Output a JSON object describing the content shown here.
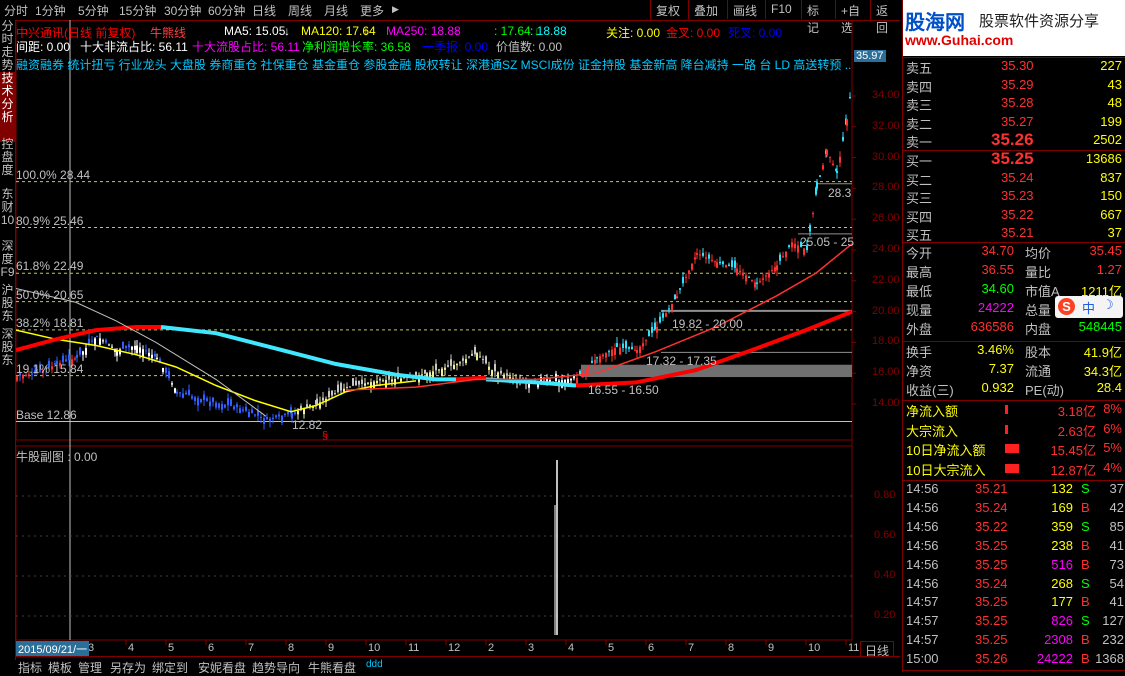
{
  "toolbar": {
    "periods": [
      "分时",
      "1分钟",
      "5分钟",
      "15分钟",
      "30分钟",
      "60分钟",
      "日线",
      "周线",
      "月线",
      "更多"
    ],
    "more_arrow": "▶",
    "right_buttons": [
      "复权",
      "叠加",
      "画线",
      "F10",
      "标记",
      "+自选",
      "返回"
    ]
  },
  "left_tabs": [
    "分时走势",
    "技术分析",
    "控盘度",
    "东财10",
    "深度F9",
    "沪股东",
    "深股东"
  ],
  "chart": {
    "title": "中兴通讯(日线 前复权)",
    "indicator_name": "牛熊线",
    "ma": [
      {
        "label": "MA5: 15.05",
        "arrow": "↓",
        "color": "#ffffff"
      },
      {
        "label": "MA120: 17.64",
        "arrow": "↓",
        "color": "#ffff00"
      },
      {
        "label": "MA250: 18.88",
        "arrow": "↓",
        "color": "#ff00ff"
      },
      {
        "label": ": 17.64",
        "arrow": "↓",
        "color": "#00ff00"
      },
      {
        "label": ": 18.88",
        "arrow": "",
        "color": "#00ffff"
      },
      {
        "label": "关注: 0.00",
        "arrow": "",
        "color": "#ffff00"
      },
      {
        "label": "金叉: 0.00",
        "arrow": "",
        "color": "#ff0000"
      },
      {
        "label": "死叉: 0.00",
        "arrow": "",
        "color": "#0000ff"
      }
    ],
    "line2": [
      {
        "label": "间距: 0.00",
        "color": "#ffffff"
      },
      {
        "label": "十大非流占比: 56.11",
        "color": "#ffffff"
      },
      {
        "label": "十大流股占比: 56.11",
        "color": "#ff00ff"
      },
      {
        "label": "净利润增长率: 36.58",
        "color": "#00ff00"
      },
      {
        "label": "一季报: 0.00",
        "color": "#0000ff"
      },
      {
        "label": "价值数: 0.00",
        "color": "#c0c0c0"
      }
    ],
    "concept_line": "融资融券 统计扭亏 行业龙头 大盘股 券商重仓 社保重仓 基金重仓 参股金融 股权转让 深港通SZ MSCI成份 证金持股 基金新高 降台减持 一路 台 LD 高送转预 ...",
    "fib_labels": [
      "100.0% 28.44",
      "80.9% 25.46",
      "61.8% 22.49",
      "50.0% 20.65",
      "38.2% 18.81",
      "19.1% 15.84",
      "Base 12.86"
    ],
    "annotations": [
      "25.05 - 25",
      "19.82 - 20.00",
      "17.32 - 17.35",
      "16.55 - 16.50",
      "28.3",
      "12.82"
    ],
    "price_axis": [
      "34.00",
      "32.00",
      "30.00",
      "28.00",
      "26.00",
      "24.00",
      "22.00",
      "20.00",
      "18.00",
      "16.00",
      "14.00"
    ],
    "price_tag": "35.97",
    "sub_title": "牛股副图 : 0.00",
    "sub_axis": [
      "0.80",
      "0.60",
      "0.40",
      "0.20"
    ],
    "date_label": "2015/09/21/一",
    "x_ticks": [
      "2",
      "3",
      "4",
      "5",
      "6",
      "7",
      "8",
      "9",
      "10",
      "11",
      "12",
      "2",
      "3",
      "4",
      "5",
      "6",
      "7",
      "8",
      "9",
      "10",
      "11"
    ],
    "period_box": "日线"
  },
  "bottom_tabs": [
    "指标",
    "模板",
    "管理",
    "另存为",
    "绑定到",
    "安妮看盘",
    "趋势导向",
    "牛熊看盘",
    "ddd"
  ],
  "panel": {
    "logo": "股海网",
    "logo_sub": "www.Guhai.com",
    "slogan": "股票软件资源分享",
    "sells": [
      {
        "label": "卖五",
        "price": "35.30",
        "vol": "227"
      },
      {
        "label": "卖四",
        "price": "35.29",
        "vol": "43"
      },
      {
        "label": "卖三",
        "price": "35.28",
        "vol": "48"
      },
      {
        "label": "卖二",
        "price": "35.27",
        "vol": "199"
      },
      {
        "label": "卖一",
        "price": "35.26",
        "vol": "2502"
      }
    ],
    "buys": [
      {
        "label": "买一",
        "price": "35.25",
        "vol": "13686"
      },
      {
        "label": "买二",
        "price": "35.24",
        "vol": "837"
      },
      {
        "label": "买三",
        "price": "35.23",
        "vol": "150"
      },
      {
        "label": "买四",
        "price": "35.22",
        "vol": "667"
      },
      {
        "label": "买五",
        "price": "35.21",
        "vol": "37"
      }
    ],
    "stats1": [
      {
        "l1": "今开",
        "v1": "34.70",
        "l2": "均价",
        "v2": "35.45"
      },
      {
        "l1": "最高",
        "v1": "36.55",
        "l2": "量比",
        "v2": "1.27"
      },
      {
        "l1": "最低",
        "v1": "34.60",
        "l2": "市值A",
        "v2": "1211亿"
      },
      {
        "l1": "现量",
        "v1": "24222",
        "l2": "总量",
        "v2": ""
      },
      {
        "l1": "外盘",
        "v1": "636586",
        "l2": "内盘",
        "v2": "548445"
      }
    ],
    "stats2": [
      {
        "l1": "换手",
        "v1": "3.46%",
        "l2": "股本",
        "v2": "41.9亿"
      },
      {
        "l1": "净资",
        "v1": "7.37",
        "l2": "流通",
        "v2": "34.3亿"
      },
      {
        "l1": "收益(三)",
        "v1": "0.932",
        "l2": "PE(动)",
        "v2": "28.4"
      }
    ],
    "flows": [
      {
        "label": "净流入额",
        "value": "3.18亿",
        "pct": "8%"
      },
      {
        "label": "大宗流入",
        "value": "2.63亿",
        "pct": "6%"
      },
      {
        "label": "10日净流入额",
        "value": "15.45亿",
        "pct": "5%"
      },
      {
        "label": "10日大宗流入",
        "value": "12.87亿",
        "pct": "4%"
      }
    ],
    "ticks": [
      {
        "t": "14:56",
        "p": "35.21",
        "v": "132",
        "s": "S",
        "n": "37"
      },
      {
        "t": "14:56",
        "p": "35.24",
        "v": "169",
        "s": "B",
        "n": "42"
      },
      {
        "t": "14:56",
        "p": "35.22",
        "v": "359",
        "s": "S",
        "n": "85"
      },
      {
        "t": "14:56",
        "p": "35.25",
        "v": "238",
        "s": "B",
        "n": "41"
      },
      {
        "t": "14:56",
        "p": "35.25",
        "v": "516",
        "s": "B",
        "n": "73"
      },
      {
        "t": "14:56",
        "p": "35.24",
        "v": "268",
        "s": "S",
        "n": "54"
      },
      {
        "t": "14:57",
        "p": "35.25",
        "v": "177",
        "s": "B",
        "n": "41"
      },
      {
        "t": "14:57",
        "p": "35.25",
        "v": "826",
        "s": "S",
        "n": "127"
      },
      {
        "t": "14:57",
        "p": "35.25",
        "v": "2308",
        "s": "B",
        "n": "232"
      },
      {
        "t": "15:00",
        "p": "35.26",
        "v": "24222",
        "s": "B",
        "n": "1368"
      }
    ],
    "ime": "中"
  }
}
